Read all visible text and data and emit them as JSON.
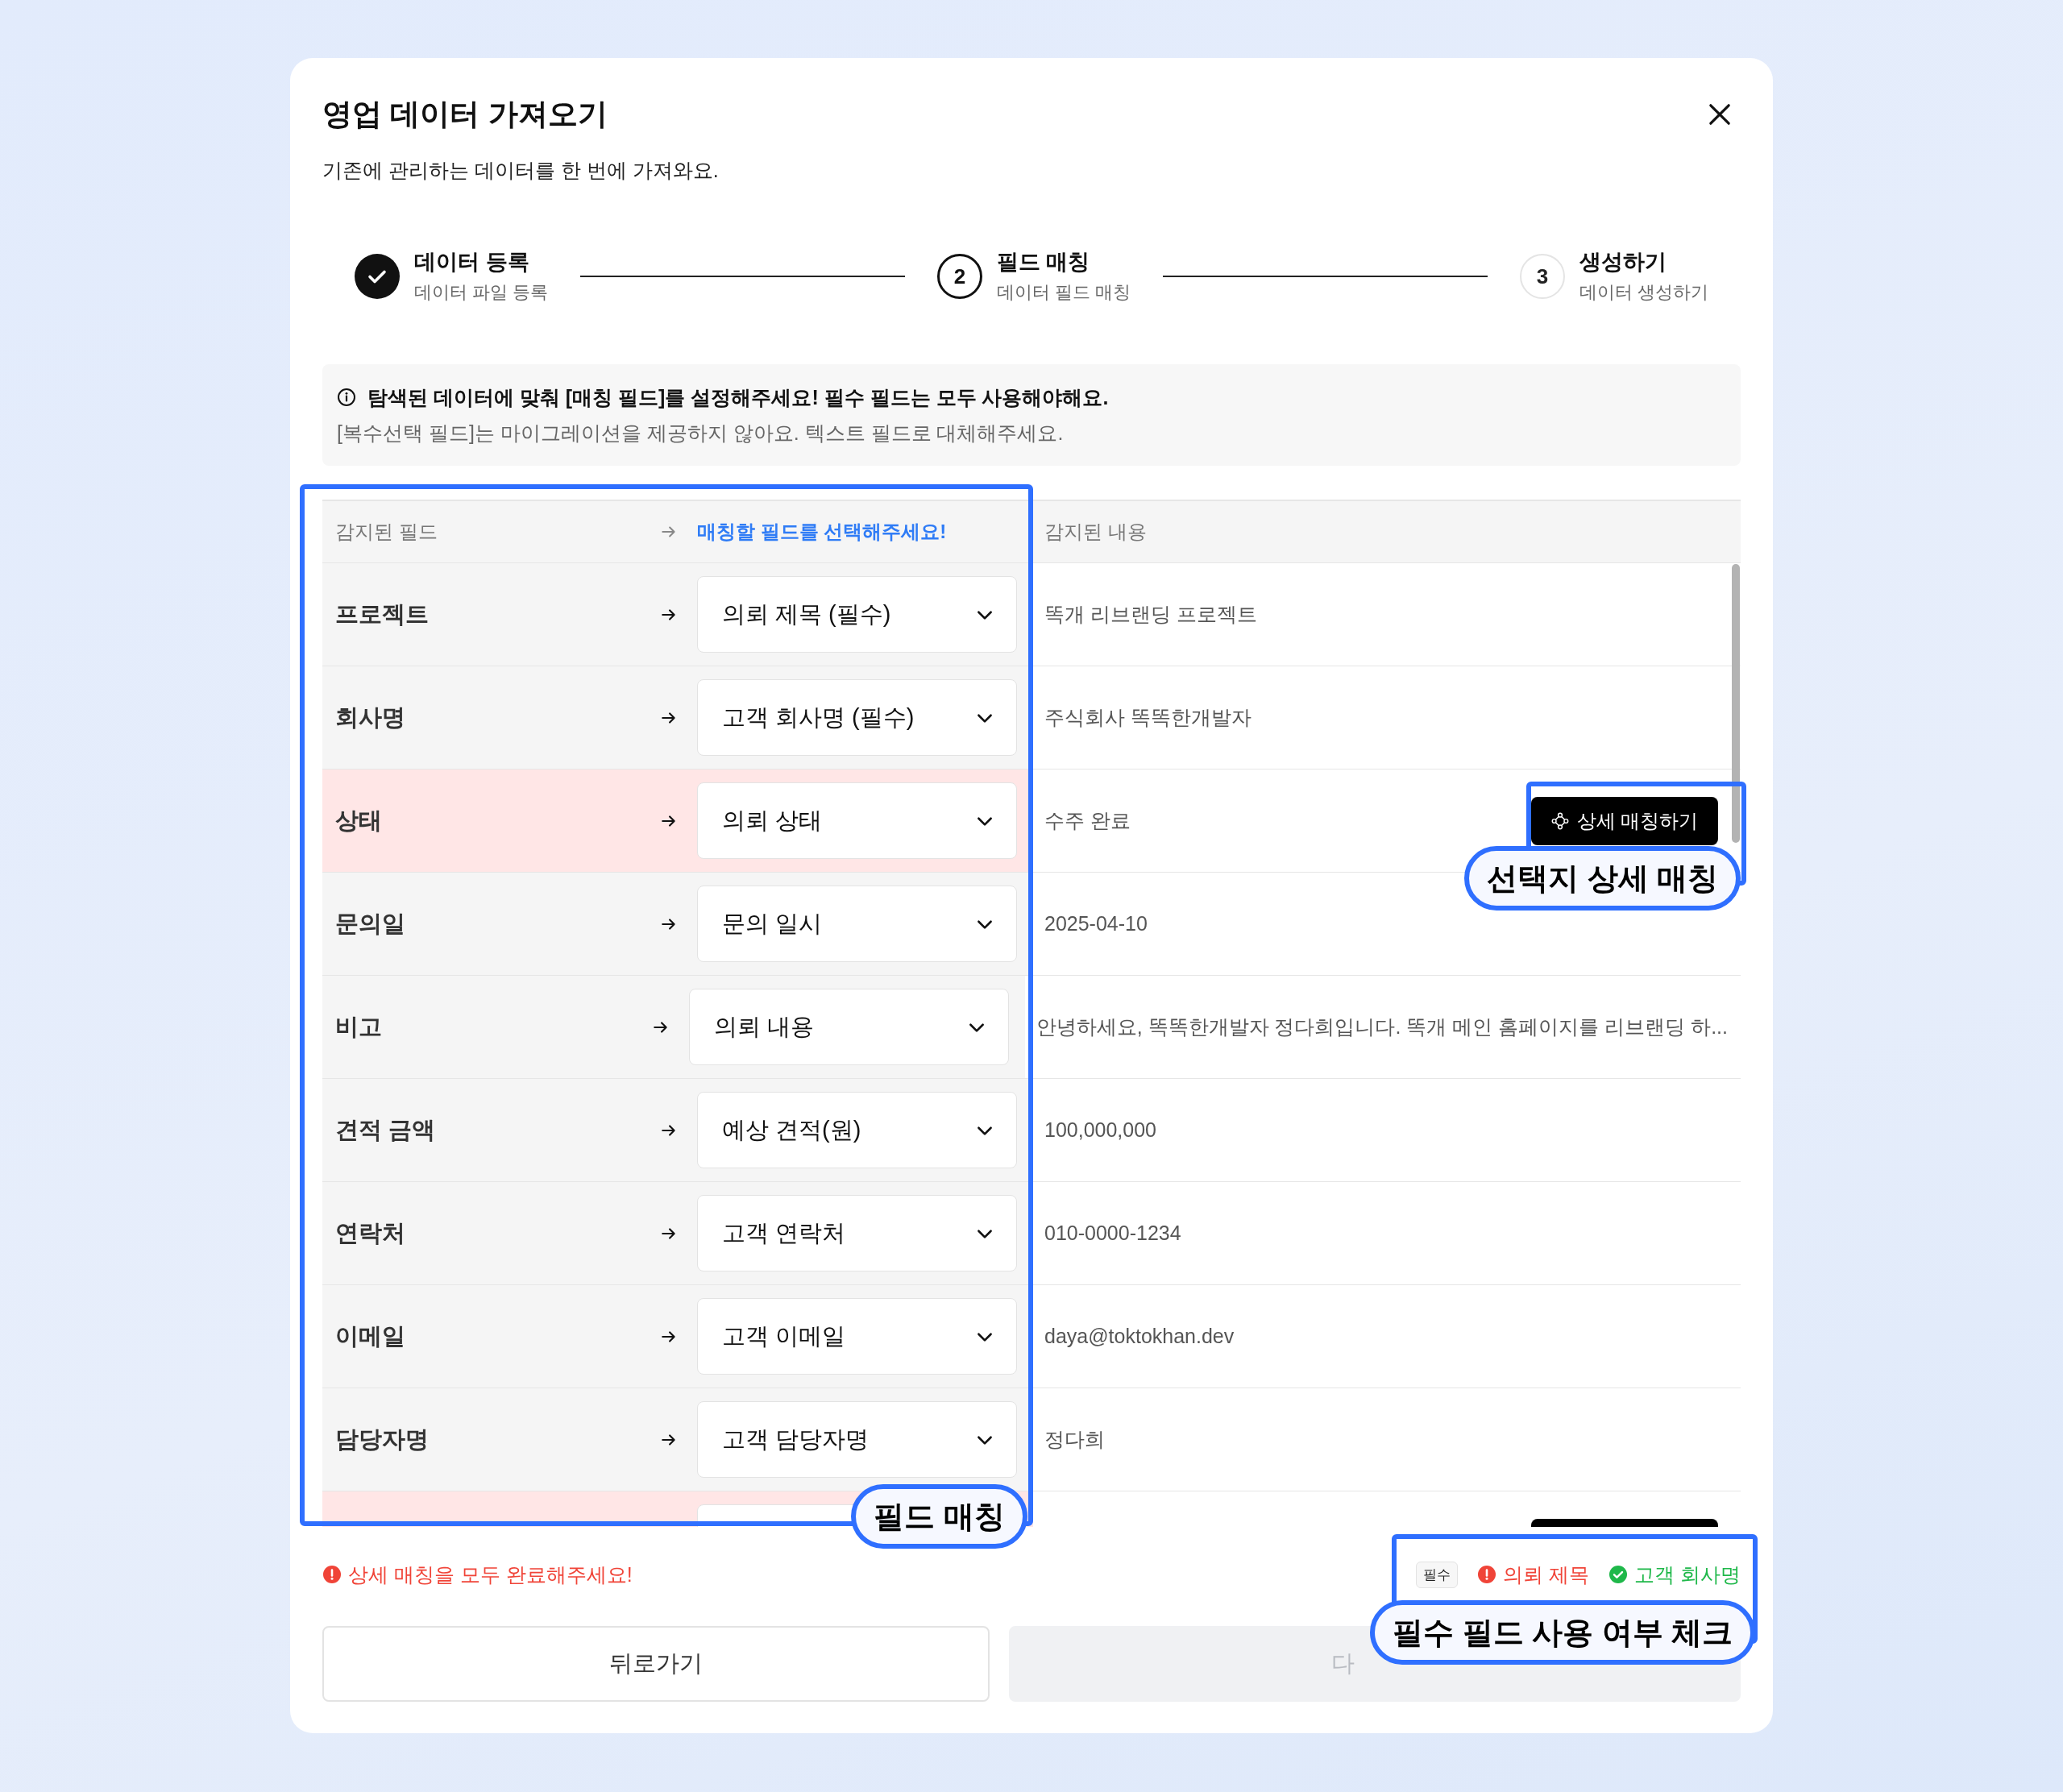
{
  "dialog": {
    "title": "영업 데이터 가져오기",
    "subtitle": "기존에 관리하는 데이터를 한 번에 가져와요."
  },
  "steps": [
    {
      "title": "데이터 등록",
      "subtitle": "데이터 파일 등록",
      "done": true
    },
    {
      "number": "2",
      "title": "필드 매칭",
      "subtitle": "데이터 필드 매칭",
      "done": false,
      "current": true
    },
    {
      "number": "3",
      "title": "생성하기",
      "subtitle": "데이터 생성하기",
      "done": false,
      "current": false
    }
  ],
  "notice": {
    "headline": "탐색된 데이터에 맞춰 [매칭 필드]를 설정해주세요! 필수 필드는 모두 사용해야해요.",
    "detail": "[복수선택 필드]는 마이그레이션을 제공하지 않아요. 텍스트 필드로 대체해주세요."
  },
  "table": {
    "columns": [
      "감지된 필드",
      "매칭할 필드를 선택해주세요!",
      "감지된 내용"
    ],
    "rows": [
      {
        "field": "프로젝트",
        "match": "의뢰 제목 (필수)",
        "content": "똑개 리브랜딩 프로젝트",
        "warning": false
      },
      {
        "field": "회사명",
        "match": "고객 회사명 (필수)",
        "content": "주식회사 똑똑한개발자",
        "warning": false
      },
      {
        "field": "상태",
        "match": "의뢰 상태",
        "content": "수주 완료",
        "warning": true,
        "detail_button": {
          "label": "상세 매칭하기"
        }
      },
      {
        "field": "문의일",
        "match": "문의 일시",
        "content": "2025-04-10",
        "warning": false
      },
      {
        "field": "비고",
        "match": "의뢰 내용",
        "content": "안녕하세요, 똑똑한개발자 정다희입니다. 똑개 메인 홈페이지를 리브랜딩 하...",
        "warning": false
      },
      {
        "field": "견적 금액",
        "match": "예상 견적(원)",
        "content": "100,000,000",
        "warning": false
      },
      {
        "field": "연락처",
        "match": "고객 연락처",
        "content": "010-0000-1234",
        "warning": false
      },
      {
        "field": "이메일",
        "match": "고객 이메일",
        "content": "daya@toktokhan.dev",
        "warning": false
      },
      {
        "field": "담당자명",
        "match": "고객 담당자명",
        "content": "정다희",
        "warning": false
      },
      {
        "warning": true,
        "detail_button": {}
      }
    ]
  },
  "footer": {
    "error": "상세 매칭을 모두 완료해주세요!",
    "required_badge": "필수",
    "required_fields": [
      {
        "label": "의뢰 제목",
        "used": false
      },
      {
        "label": "고객 회사명",
        "used": true
      }
    ]
  },
  "buttons": [
    {
      "label": "뒤로가기",
      "disabled": false
    },
    {
      "label": "다",
      "disabled": true
    }
  ],
  "annotations": [
    {
      "label": "필드 매칭"
    },
    {
      "label": "선택지 상세 매칭"
    },
    {
      "label": "필수 필드 사용 여부 체크"
    }
  ]
}
